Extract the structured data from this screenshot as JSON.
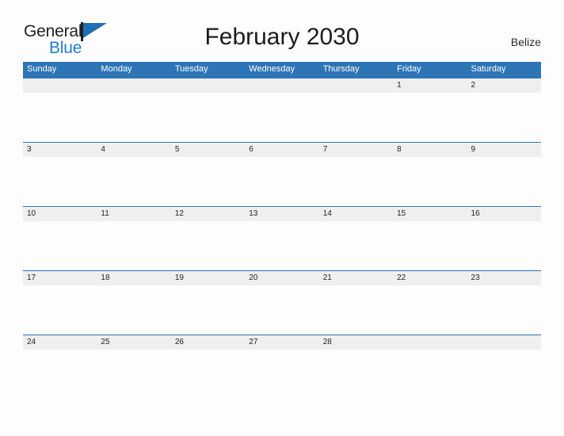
{
  "brand": {
    "name_top": "General",
    "name_bottom": "Blue",
    "flag_color": "#1f6fb6",
    "text_color_top": "#231f20",
    "text_color_bottom": "#1f7fd4",
    "icon": "flag-triangle-icon"
  },
  "header": {
    "title": "February 2030",
    "region": "Belize"
  },
  "calendar": {
    "month": "February",
    "year": "2030",
    "header_color": "#2e75b6",
    "cell_band_color": "#efefef",
    "weekday_headers": [
      "Sunday",
      "Monday",
      "Tuesday",
      "Wednesday",
      "Thursday",
      "Friday",
      "Saturday"
    ],
    "weeks": [
      [
        "",
        "",
        "",
        "",
        "",
        "1",
        "2"
      ],
      [
        "3",
        "4",
        "5",
        "6",
        "7",
        "8",
        "9"
      ],
      [
        "10",
        "11",
        "12",
        "13",
        "14",
        "15",
        "16"
      ],
      [
        "17",
        "18",
        "19",
        "20",
        "21",
        "22",
        "23"
      ],
      [
        "24",
        "25",
        "26",
        "27",
        "28",
        "",
        ""
      ]
    ]
  }
}
